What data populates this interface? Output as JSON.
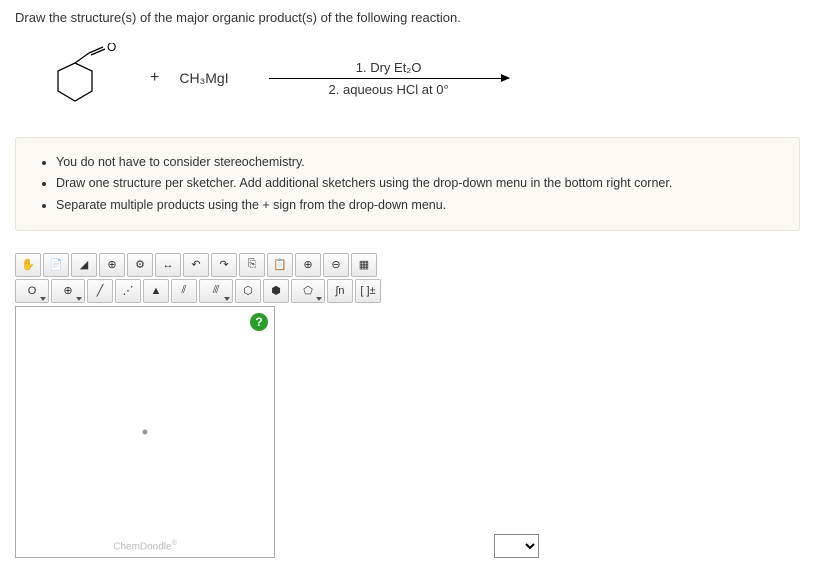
{
  "question": "Draw the structure(s) of the major organic product(s) of the following reaction.",
  "reaction": {
    "plus": "+",
    "reagent": "CH₃MgI",
    "condition1": "1. Dry Et₂O",
    "condition2": "2. aqueous HCl at 0°"
  },
  "instructions": [
    "You do not have to consider stereochemistry.",
    "Draw one structure per sketcher. Add additional sketchers using the drop-down menu in the bottom right corner.",
    "Separate multiple products using the + sign from the drop-down menu."
  ],
  "toolbar1": {
    "move": "✋",
    "open": "📄",
    "erase": "◢",
    "center": "⊕",
    "clean": "⚙",
    "flip": "↔",
    "undo": "↶",
    "redo": "↷",
    "copy": "⎘",
    "paste": "📋",
    "zoomIn": "⊕",
    "zoomOut": "⊖",
    "color": "▦"
  },
  "toolbar2": {
    "element": "O",
    "increase": "⊕",
    "bond1": "╱",
    "bond2": "⋰",
    "bond3": "▲",
    "bond4": "⫽",
    "bond5": "⫻",
    "ring1": "⬡",
    "ring2": "⬢",
    "ring3": "⬠",
    "custom": "∫n",
    "charge": "[ ]±"
  },
  "help": "?",
  "brand": "ChemDoodle",
  "dropdown": ""
}
